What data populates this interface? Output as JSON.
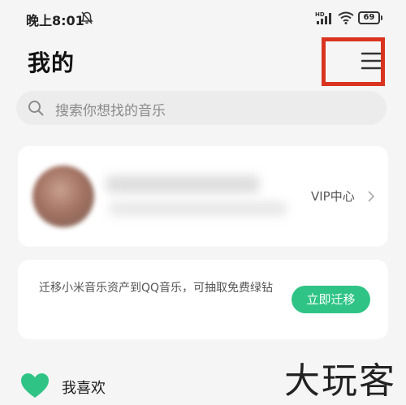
{
  "status_bar": {
    "time": "晚上8:01",
    "battery": "69",
    "icons": [
      "bell-mute-icon",
      "hd-signal-icon",
      "wifi-icon",
      "battery-icon"
    ]
  },
  "header": {
    "title": "我的",
    "menu_icon": "hamburger-menu-icon"
  },
  "search": {
    "placeholder": "搜索你想找的音乐",
    "icon": "search-icon"
  },
  "profile": {
    "vip_label": "VIP中心",
    "chevron_icon": "chevron-right-icon"
  },
  "migrate": {
    "text": "迁移小米音乐资产到QQ音乐，可抽取免费绿钻",
    "button_label": "立即迁移",
    "button_color": "#2fc486"
  },
  "favorites": {
    "label": "我喜欢",
    "icon": "heart-icon",
    "icon_color": "#2fc486"
  },
  "watermark": "大玩客",
  "colors": {
    "accent": "#2fc486",
    "highlight_box": "#d9341f",
    "background": "#f5f5f5"
  }
}
